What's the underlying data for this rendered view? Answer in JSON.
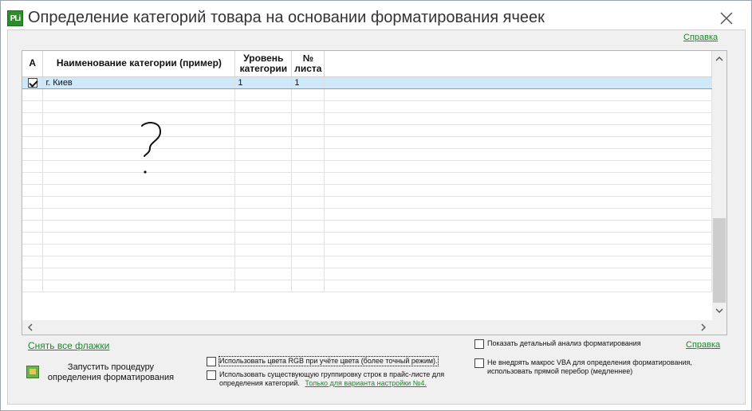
{
  "window": {
    "title": "Определение категорий товара на основании форматирования ячеек",
    "app_icon_text": "PLi",
    "close_icon": "close-icon"
  },
  "help_top": "Справка",
  "grid": {
    "columns": [
      {
        "key": "a",
        "label": "A"
      },
      {
        "key": "name",
        "label": "Наименование категории (пример)"
      },
      {
        "key": "level",
        "label": "Уровень категории"
      },
      {
        "key": "sheet",
        "label": "№ листа"
      }
    ],
    "rows": [
      {
        "checked": true,
        "name": "г. Киев",
        "level": "1",
        "sheet": "1",
        "selected": true
      }
    ],
    "empty_rows": 17,
    "annotation": "?"
  },
  "bottom": {
    "clear_link": "Снять все флажки",
    "run_button": "Запустить процедуру определения форматирования",
    "option_rgb": "Использовать цвета RGB при учёте цвета (более точный режим).",
    "option_grouping": "Использовать существующую группировку строк в прайс-листе для определения категорий.",
    "option_grouping_link": "Только для варианта настройки №4.",
    "option_detail": "Показать детальный анализ форматирования",
    "option_vba": "Не внедрять макрос VBA для определения форматирования, использовать прямой перебор (медленнее)",
    "help_bottom": "Справка"
  },
  "colors": {
    "link": "#1a8a2a",
    "selected_row": "#cfe8fa"
  }
}
